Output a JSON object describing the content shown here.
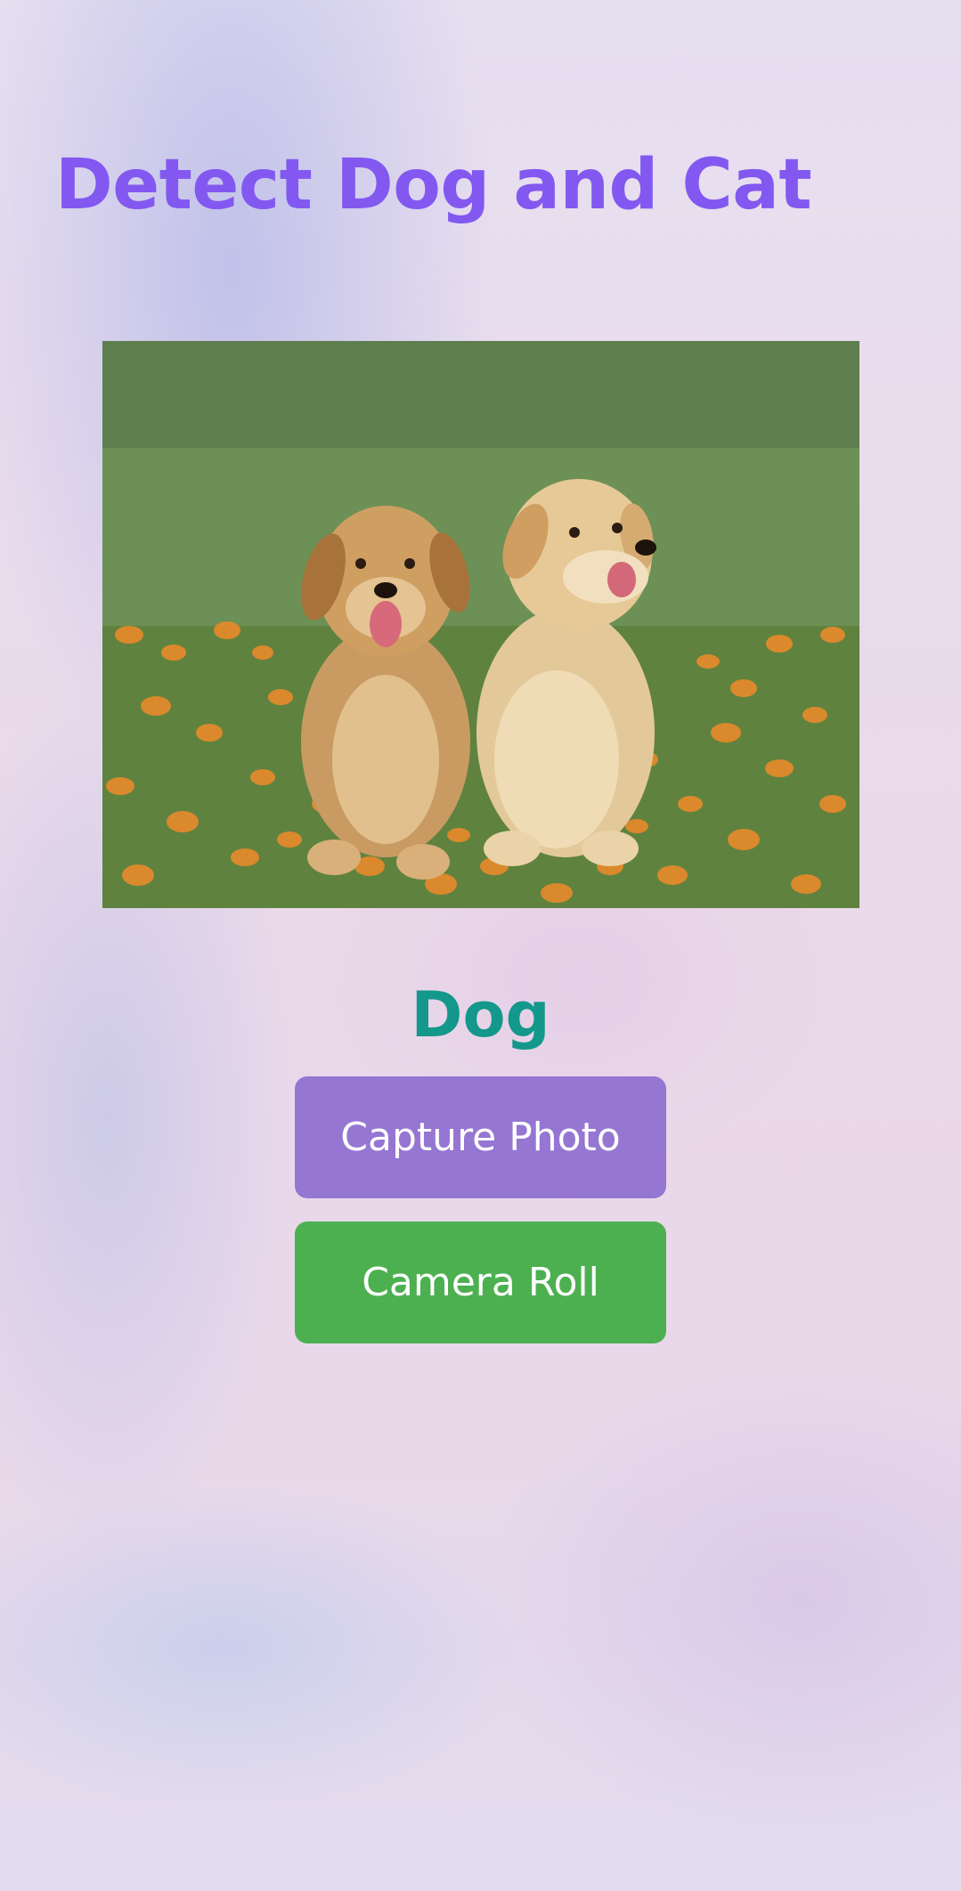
{
  "header": {
    "title": "Detect Dog and Cat"
  },
  "preview": {
    "image_alt": "two golden retriever puppies on grass with orange flowers"
  },
  "result": {
    "label": "Dog"
  },
  "actions": {
    "capture_label": "Capture Photo",
    "camera_roll_label": "Camera Roll"
  },
  "colors": {
    "title": "#8258f0",
    "result": "#13988b",
    "capture_button": "#9576d2",
    "camera_roll_button": "#4cb050"
  }
}
